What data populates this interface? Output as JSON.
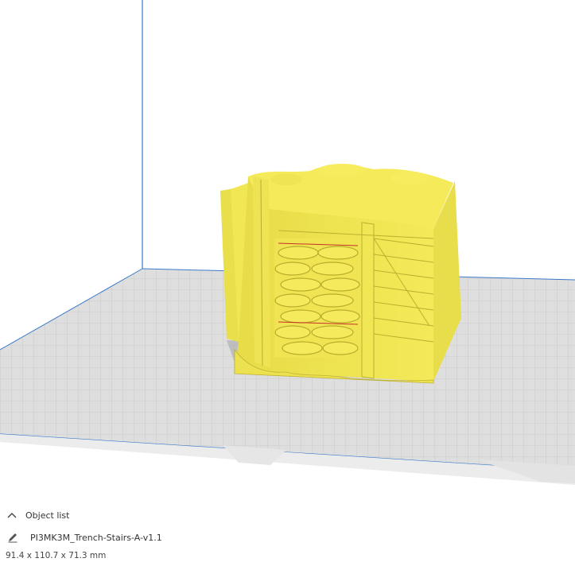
{
  "object_list": {
    "label": "Object list",
    "expand_icon": "chevron-up-icon"
  },
  "object": {
    "name": "PI3MK3M_Trench-Stairs-A-v1.1",
    "edit_icon": "pencil-icon",
    "dimensions": "91.4 x 110.7 x 71.3 mm"
  },
  "colors": {
    "model": "#f2e64f",
    "build_plate": "#d7d7d7",
    "axis_blue": "#3b7ac9"
  }
}
